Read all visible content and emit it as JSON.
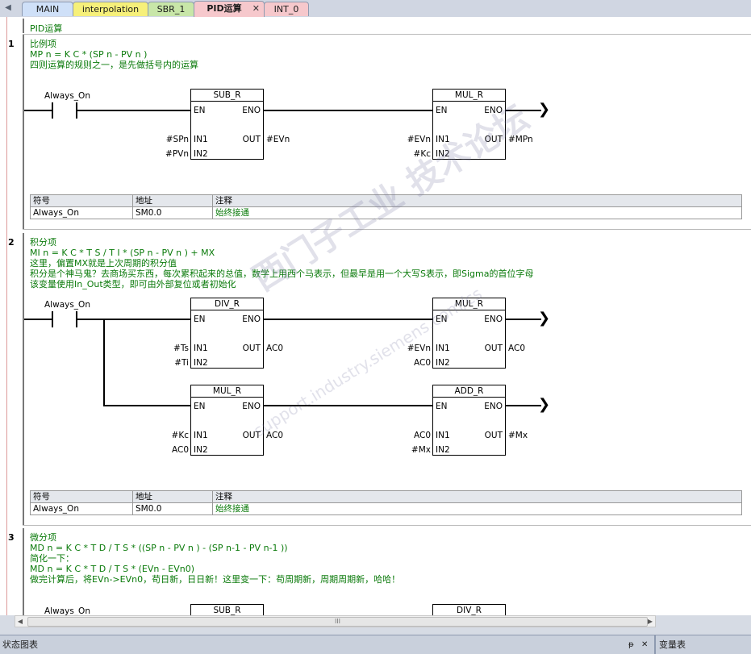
{
  "tabs": [
    {
      "label": "MAIN",
      "color": "#cfe0f8"
    },
    {
      "label": "interpolation",
      "color": "#f6f07a"
    },
    {
      "label": "SBR_1",
      "color": "#c8e6a8"
    },
    {
      "label": "PID运算",
      "color": "#f6c8cc",
      "active": true
    },
    {
      "label": "INT_0",
      "color": "#f6c8cc"
    }
  ],
  "program_comment": "PID运算",
  "networks": [
    {
      "number": "1",
      "comments": [
        "比例项",
        "MP n = K C * (SP n - PV n )",
        "四则运算的规则之一，是先做括号内的运算"
      ],
      "contact": "Always_On",
      "boxes": [
        {
          "name": "SUB_R",
          "en": "EN",
          "eno": "ENO",
          "in1": "IN1",
          "in2": "IN2",
          "out": "OUT",
          "in1_val": "#SPn",
          "in2_val": "#PVn",
          "out_val": "#EVn"
        },
        {
          "name": "MUL_R",
          "en": "EN",
          "eno": "ENO",
          "in1": "IN1",
          "in2": "IN2",
          "out": "OUT",
          "in1_val": "#EVn",
          "in2_val": "#Kc",
          "out_val": "#MPn"
        }
      ],
      "symbol_table": {
        "headers": [
          "符号",
          "地址",
          "注释"
        ],
        "rows": [
          [
            "Always_On",
            "SM0.0",
            "始终接通"
          ]
        ]
      }
    },
    {
      "number": "2",
      "comments": [
        "积分项",
        "MI n = K C * T S / T I * (SP n - PV n ) + MX",
        "这里，偏置MX就是上次周期的积分值",
        "积分是个神马鬼？去商场买东西，每次累积起来的总值，数学上用西个马表示，但最早是用一个大写S表示，即Sigma的首位字母",
        "该变量使用In_Out类型，即可由外部复位或者初始化"
      ],
      "contact": "Always_On",
      "boxes": [
        {
          "name": "DIV_R",
          "en": "EN",
          "eno": "ENO",
          "in1": "IN1",
          "in2": "IN2",
          "out": "OUT",
          "in1_val": "#Ts",
          "in2_val": "#Ti",
          "out_val": "AC0"
        },
        {
          "name": "MUL_R",
          "en": "EN",
          "eno": "ENO",
          "in1": "IN1",
          "in2": "IN2",
          "out": "OUT",
          "in1_val": "#EVn",
          "in2_val": "AC0",
          "out_val": "AC0"
        },
        {
          "name": "MUL_R",
          "en": "EN",
          "eno": "ENO",
          "in1": "IN1",
          "in2": "IN2",
          "out": "OUT",
          "in1_val": "#Kc",
          "in2_val": "AC0",
          "out_val": "AC0"
        },
        {
          "name": "ADD_R",
          "en": "EN",
          "eno": "ENO",
          "in1": "IN1",
          "in2": "IN2",
          "out": "OUT",
          "in1_val": "AC0",
          "in2_val": "#Mx",
          "out_val": "#Mx"
        }
      ],
      "symbol_table": {
        "headers": [
          "符号",
          "地址",
          "注释"
        ],
        "rows": [
          [
            "Always_On",
            "SM0.0",
            "始终接通"
          ]
        ]
      }
    },
    {
      "number": "3",
      "comments": [
        "微分项",
        "MD n = K C * T D / T S * ((SP n - PV n ) - (SP n-1 - PV n-1 ))",
        "简化一下：",
        "MD n = K C * T D / T S * (EVn  -  EVn0)",
        "做完计算后，将EVn->EVn0，苟日新，日日新！这里变一下：苟周期新，周期周期新，哈哈！"
      ],
      "contact": "Always_On",
      "boxes": [
        {
          "name": "SUB_R"
        },
        {
          "name": "DIV_R"
        }
      ]
    }
  ],
  "watermark": {
    "line1": "西门子工业  技术论坛",
    "line2": "support.industry.siemens.com/cs"
  },
  "scrollbar_grip": "III",
  "status_panels": {
    "left": "状态图表",
    "right": "变量表",
    "pin": "ᵽ",
    "close": "✕"
  }
}
